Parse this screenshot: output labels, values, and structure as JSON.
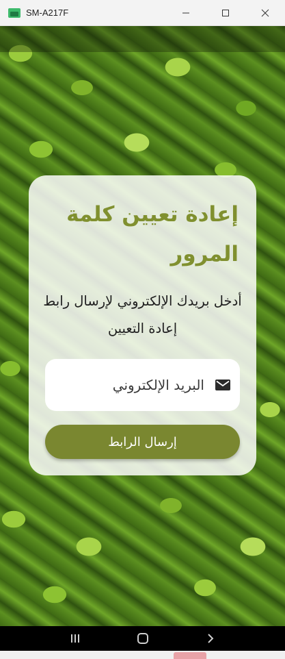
{
  "window": {
    "title": "SM-A217F",
    "controls": {
      "minimize": "minimize-icon",
      "maximize": "maximize-icon",
      "close": "close-icon"
    }
  },
  "card": {
    "title": "إعادة تعيين كلمة المرور",
    "description": "أدخل بريدك الإلكتروني لإرسال رابط إعادة التعيين",
    "email_placeholder": "البريد الإلكتروني",
    "email_icon": "mail-icon",
    "send_button": "إرسال الرابط"
  },
  "nav": {
    "recents": "recents-icon",
    "home": "home-icon",
    "back": "back-icon"
  },
  "colors": {
    "accent": "#80902f",
    "button": "#7a8730",
    "card_bg": "#ffffff",
    "text": "#1f1f1f"
  }
}
